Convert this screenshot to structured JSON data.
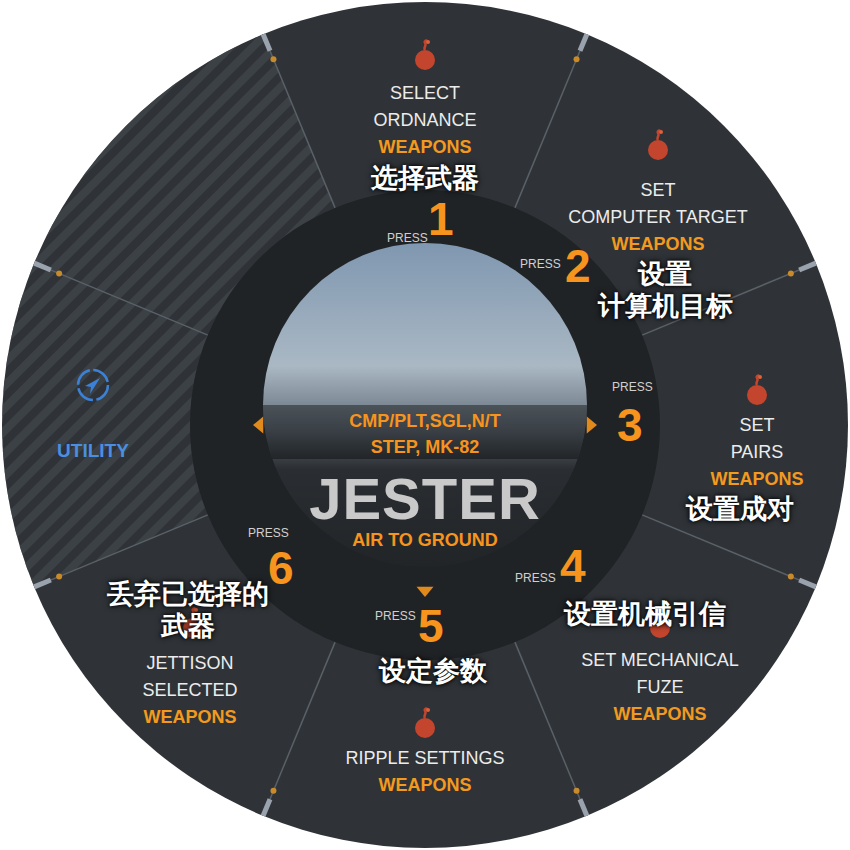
{
  "center": {
    "status_lines": [
      "CMP/PLT,SGL,N/T",
      "STEP, MK-82"
    ],
    "title": "JESTER",
    "subtitle": "AIR TO GROUND"
  },
  "utility": {
    "label": "UTILITY"
  },
  "items": [
    {
      "number": "1",
      "press": "PRESS",
      "label_lines": [
        "SELECT",
        "ORDNANCE"
      ],
      "category": "WEAPONS",
      "translation_lines": [
        "选择武器"
      ]
    },
    {
      "number": "2",
      "press": "PRESS",
      "label_lines": [
        "SET",
        "COMPUTER TARGET"
      ],
      "category": "WEAPONS",
      "translation_lines": [
        "设置",
        "计算机目标"
      ]
    },
    {
      "number": "3",
      "press": "PRESS",
      "label_lines": [
        "SET",
        "PAIRS"
      ],
      "category": "WEAPONS",
      "translation_lines": [
        "设置成对"
      ]
    },
    {
      "number": "4",
      "press": "PRESS",
      "label_lines": [
        "SET MECHANICAL",
        "FUZE"
      ],
      "category": "WEAPONS",
      "translation_lines": [
        "设置机械引信"
      ]
    },
    {
      "number": "5",
      "press": "PRESS",
      "label_lines": [
        "RIPPLE SETTINGS"
      ],
      "category": "WEAPONS",
      "translation_lines": [
        "设定参数"
      ]
    },
    {
      "number": "6",
      "press": "PRESS",
      "label_lines": [
        "JETTISON",
        "SELECTED"
      ],
      "category": "WEAPONS",
      "translation_lines": [
        "丢弃已选择的",
        "武器"
      ]
    }
  ]
}
